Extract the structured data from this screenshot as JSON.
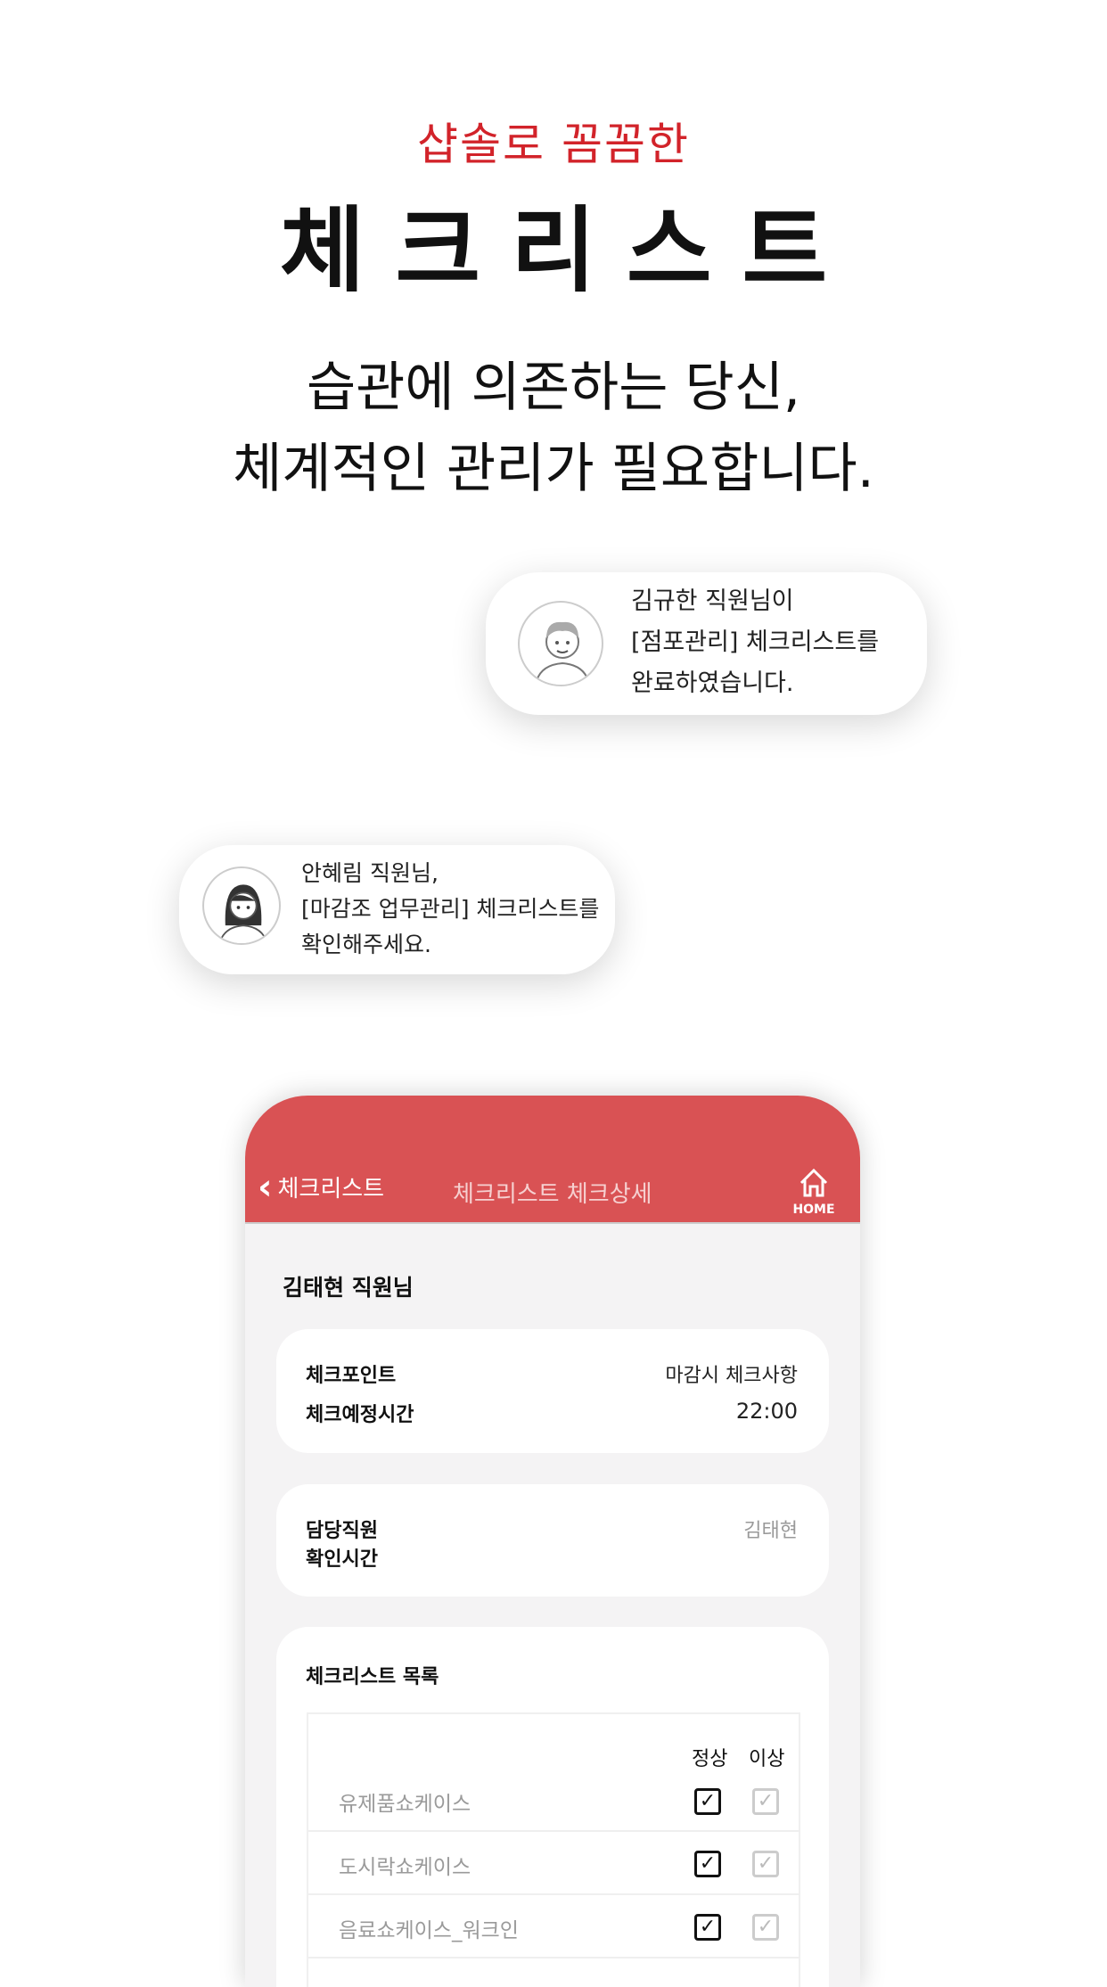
{
  "hero": {
    "subtitle": "샵솔로 꼼꼼한",
    "title": "체크리스트",
    "body_line1": "습관에 의존하는 당신,",
    "body_line2": "체계적인 관리가 필요합니다."
  },
  "notifications": [
    {
      "lines": [
        "김규한 직원님이",
        "[점포관리] 체크리스트를",
        "완료하였습니다."
      ]
    },
    {
      "lines": [
        "안혜림 직원님,",
        "[마감조 업무관리] 체크리스트를",
        "확인해주세요."
      ]
    }
  ],
  "app": {
    "back_label": "체크리스트",
    "header_title": "체크리스트 체크상세",
    "home_label": "HOME",
    "user_name": "김태현  직원님",
    "info_card": {
      "rows": [
        {
          "label": "체크포인트",
          "value": "마감시 체크사항"
        },
        {
          "label": "체크예정시간",
          "value": "22:00"
        }
      ]
    },
    "staff_card": {
      "rows": [
        {
          "label": "담당직원",
          "value": "김태현"
        },
        {
          "label": "확인시간",
          "value": ""
        }
      ]
    },
    "checklist": {
      "title": "체크리스트 목록",
      "col_normal": "정상",
      "col_abnormal": "이상",
      "items": [
        {
          "name": "유제품쇼케이스",
          "normal": true,
          "abnormal": false
        },
        {
          "name": "도시락쇼케이스",
          "normal": true,
          "abnormal": false
        },
        {
          "name": "음료쇼케이스_워크인",
          "normal": true,
          "abnormal": false
        }
      ]
    }
  },
  "colors": {
    "accent": "#d2232a",
    "header": "#d95254"
  }
}
